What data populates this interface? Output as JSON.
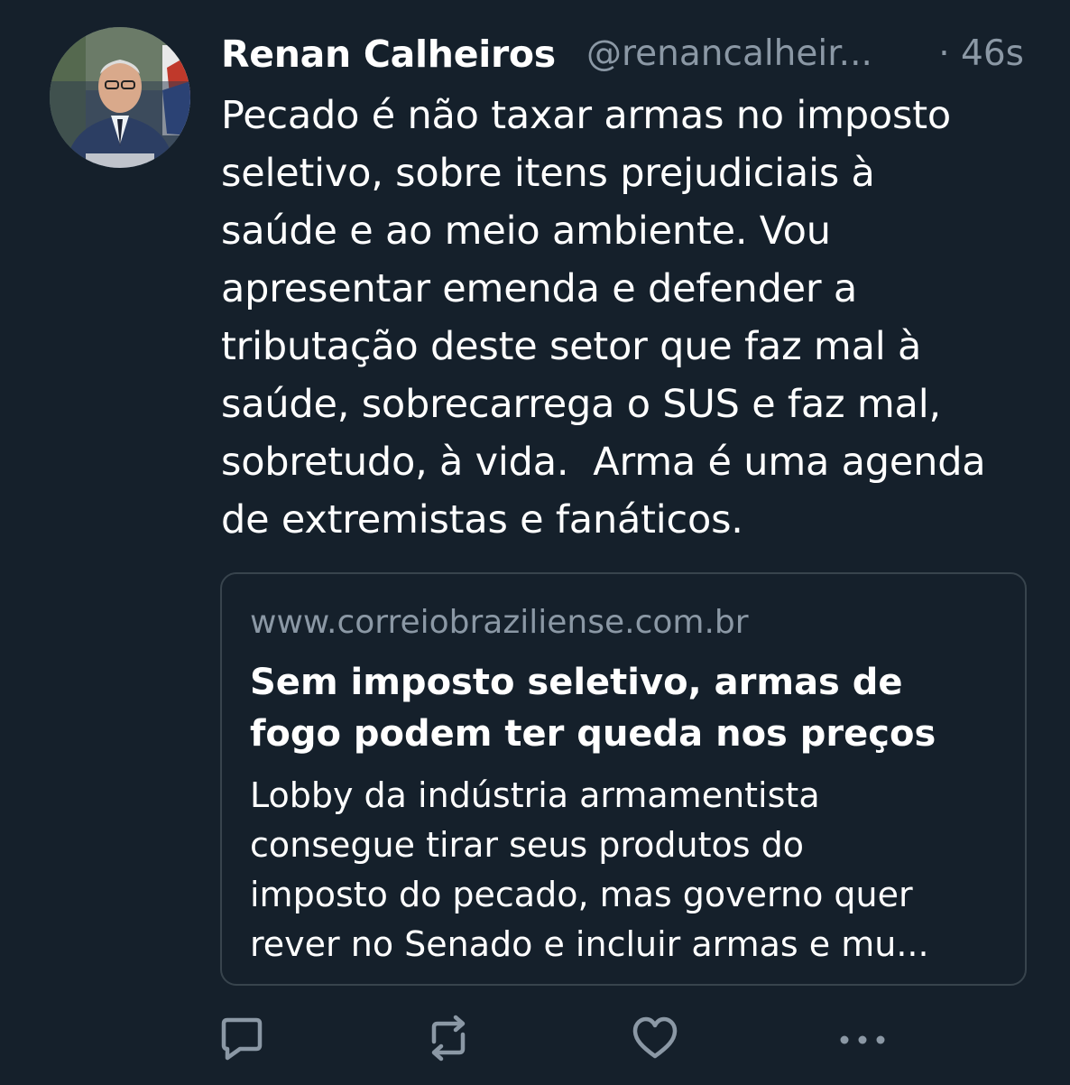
{
  "tweet": {
    "author_name": "Renan Calheiros",
    "author_handle": "@renancalheir...",
    "timestamp": "· 46s",
    "text_lines": [
      "Pecado é não taxar armas no imposto",
      "seletivo, sobre itens prejudiciais à",
      "saúde e ao meio ambiente. Vou",
      "apresentar emenda e defender a",
      "tributação deste setor que faz mal à",
      "saúde, sobrecarrega o SUS e faz mal,",
      "sobretudo, à vida.  Arma é uma agenda",
      "de extremistas e fanáticos."
    ]
  },
  "card": {
    "domain": "www.correiobraziliense.com.br",
    "title_lines": [
      "Sem imposto seletivo, armas de",
      "fogo podem ter queda nos preços"
    ],
    "description_lines": [
      "Lobby da indústria armamentista",
      "consegue tirar seus produtos do",
      "imposto do pecado, mas governo quer",
      "rever no Senado e incluir armas e mu..."
    ]
  },
  "actions": {
    "reply_icon": "comment-icon",
    "retweet_icon": "retweet-icon",
    "like_icon": "heart-icon",
    "more_icon": "more-dots-icon"
  },
  "colors": {
    "background": "#15202b",
    "text_primary": "#ffffff",
    "text_secondary": "#8b98a5",
    "border": "#38444d"
  }
}
